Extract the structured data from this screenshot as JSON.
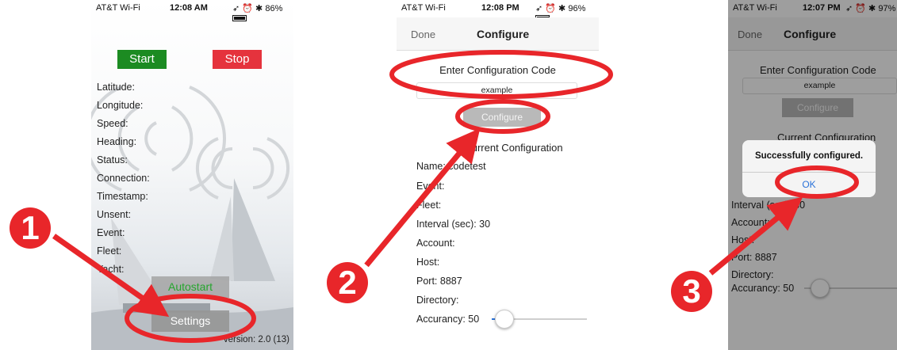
{
  "status_bar_1": {
    "carrier": "AT&T Wi-Fi",
    "time": "12:08 AM",
    "battery": "86%",
    "battery_level": 0.86
  },
  "status_bar_2": {
    "carrier": "AT&T Wi-Fi",
    "time": "12:08 PM",
    "battery": "96%",
    "battery_level": 0.96
  },
  "status_bar_3": {
    "carrier": "AT&T Wi-Fi",
    "time": "12:07 PM",
    "battery": "97%",
    "battery_level": 0.97
  },
  "screen1": {
    "start_label": "Start",
    "stop_label": "Stop",
    "fields": [
      "Latitude:",
      "Longitude:",
      "Speed:",
      "Heading:",
      "Status:",
      "Connection:",
      "Timestamp:",
      "Unsent:",
      "Event:",
      "Fleet:",
      "Yacht:"
    ],
    "autostart_label": "Autostart",
    "settings_label": "Settings",
    "version": "version: 2.0 (13)"
  },
  "screen2": {
    "done_label": "Done",
    "title": "Configure",
    "enter_code_heading": "Enter Configuration Code",
    "code_value": "example",
    "configure_button_label": "Configure",
    "current_config_heading": "Current Configuration",
    "fields": [
      "Name: codetest",
      "Event:",
      "Fleet:",
      "Interval (sec): 30",
      "Account:",
      "Host:",
      "Port: 8887",
      "Directory:"
    ],
    "accuracy_label": "Accurancy: 50",
    "accuracy_value": 50
  },
  "screen3": {
    "done_label": "Done",
    "title": "Configure",
    "enter_code_heading": "Enter Configuration Code",
    "code_value": "example",
    "configure_button_label": "Configure",
    "current_config_heading": "Current Configuration",
    "fields": [
      "Interval (sec): 30",
      "Account:",
      "Host:",
      "Port: 8887",
      "Directory:"
    ],
    "accuracy_label": "Accurancy: 50",
    "alert_message": "Successfully configured.",
    "alert_ok_label": "OK"
  },
  "steps": [
    "1",
    "2",
    "3"
  ],
  "colors": {
    "annotation_red": "#e8262a",
    "start_green": "#1c8b22",
    "stop_red": "#e5333d",
    "ios_blue": "#2a72d9",
    "slider_blue": "#2a72d9"
  }
}
